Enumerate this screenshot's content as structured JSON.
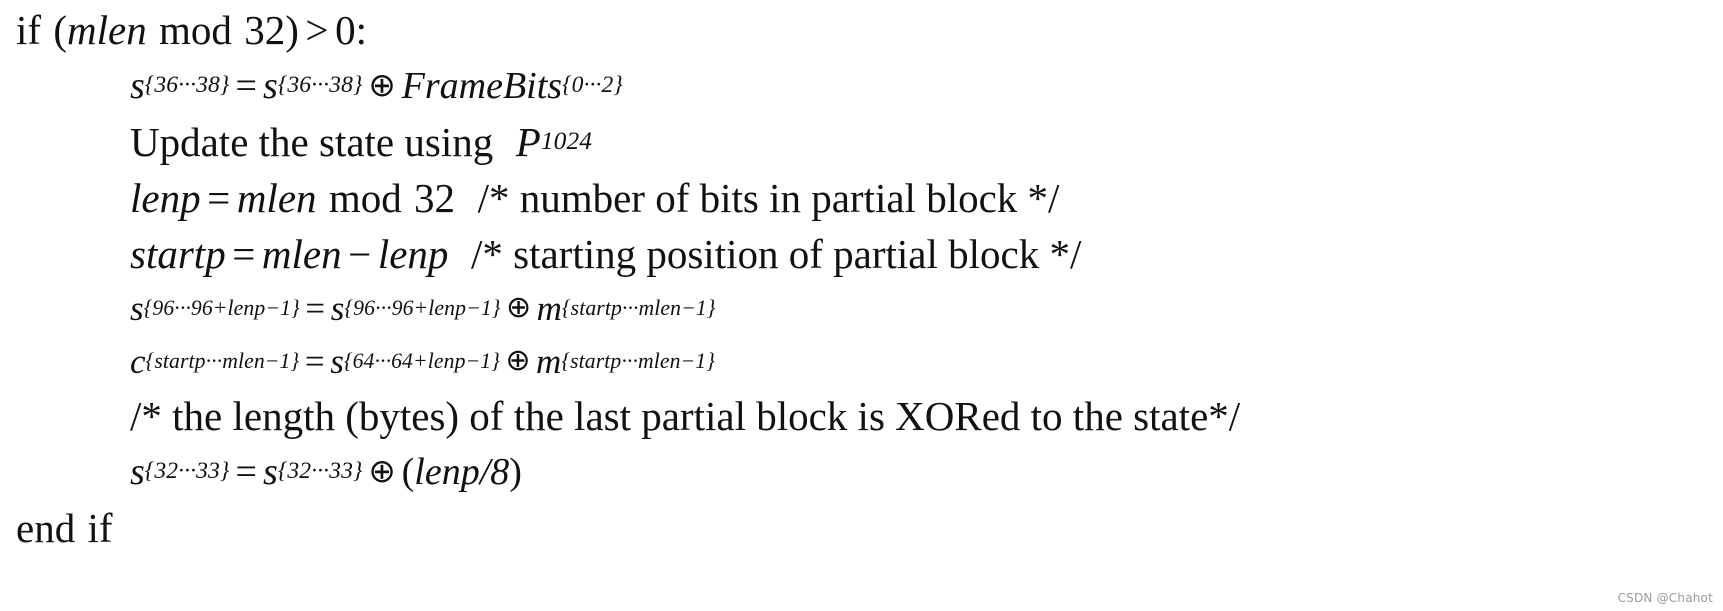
{
  "document": {
    "kind": "algorithm-pseudocode",
    "background_color": "#ffffff",
    "text_color": "#111111"
  },
  "lines": {
    "l1_if": {
      "if_kw": "if",
      "open_paren": "(",
      "mlen": "mlen",
      "mod": "mod",
      "modulus": "32",
      "close_paren": ")",
      "gt": ">",
      "zero": "0",
      "colon": ":"
    },
    "l2_framebits": {
      "lhs_var": "s",
      "lhs_sub": "{36···38}",
      "eq": "=",
      "rhs_var": "s",
      "rhs_sub": "{36···38}",
      "xor": "⊕",
      "framebits": "FrameBits",
      "framebits_sub": "{0···2}"
    },
    "l3_update": {
      "text": "Update the state using",
      "perm": "P",
      "perm_sub": "1024"
    },
    "l4_lenp": {
      "lenp": "lenp",
      "eq": "=",
      "mlen": "mlen",
      "mod": "mod",
      "modulus": "32",
      "comment": "/* number of bits in partial block */"
    },
    "l5_startp": {
      "startp": "startp",
      "eq": "=",
      "mlen": "mlen",
      "minus": "−",
      "lenp": "lenp",
      "comment": "/* starting position of partial block */"
    },
    "l6_state_xor_msg": {
      "lhs_var": "s",
      "lhs_sub": "{96···96+lenp−1}",
      "eq": "=",
      "rhs_var": "s",
      "rhs_sub": "{96···96+lenp−1}",
      "xor": "⊕",
      "msg_var": "m",
      "msg_sub": "{startp···mlen−1}"
    },
    "l7_ciphertext": {
      "lhs_var": "c",
      "lhs_sub": "{startp···mlen−1}",
      "eq": "=",
      "rhs_var": "s",
      "rhs_sub": "{64···64+lenp−1}",
      "xor": "⊕",
      "msg_var": "m",
      "msg_sub": "{startp···mlen−1}"
    },
    "l8_comment": {
      "text": "/* the length (bytes) of the last partial block is XORed to the state*/"
    },
    "l9_length_xor": {
      "lhs_var": "s",
      "lhs_sub": "{32···33}",
      "eq": "=",
      "rhs_var": "s",
      "rhs_sub": "{32···33}",
      "xor": "⊕",
      "open_paren": "(",
      "lenp": "lenp",
      "div": "/8",
      "close_paren": ")"
    },
    "l10_end": {
      "end_kw": "end",
      "if_kw": "if"
    }
  },
  "watermark": {
    "text": "CSDN @Chahot",
    "color": "#9a9a9a"
  }
}
